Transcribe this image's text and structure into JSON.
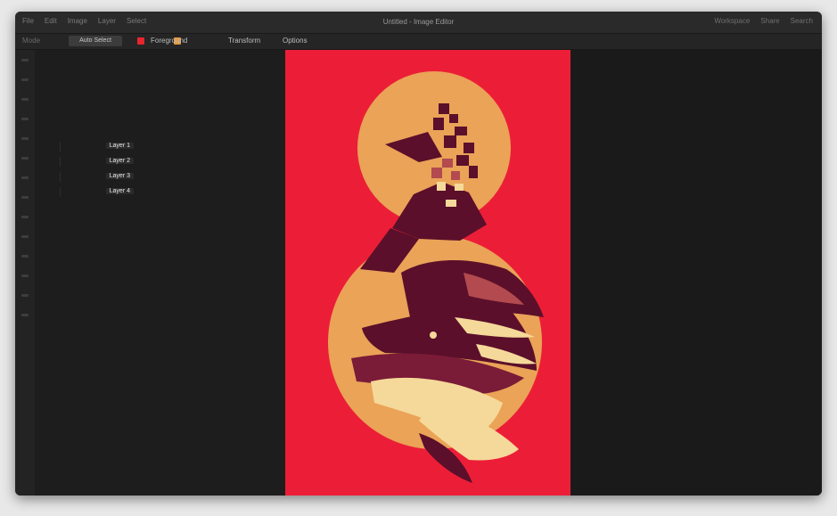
{
  "window": {
    "title": "Untitled - Image Editor",
    "menu": [
      "File",
      "Edit",
      "Image",
      "Layer",
      "Select"
    ],
    "right_items": [
      "Workspace",
      "Share",
      "Search"
    ]
  },
  "toolbar": {
    "label": "Mode",
    "pill": "Auto Select",
    "items": [
      "Foreground",
      "Transform",
      "Options"
    ],
    "colors": {
      "red": "#e8252d",
      "orange": "#e39a3f"
    }
  },
  "panel": {
    "rows": [
      "Layer 1",
      "Layer 2",
      "Layer 3",
      "Layer 4"
    ]
  },
  "artwork": {
    "background": "#ec1e37",
    "circle_color": "#eaa357",
    "dark": "#5b0f2a",
    "cream": "#f5d99a"
  }
}
